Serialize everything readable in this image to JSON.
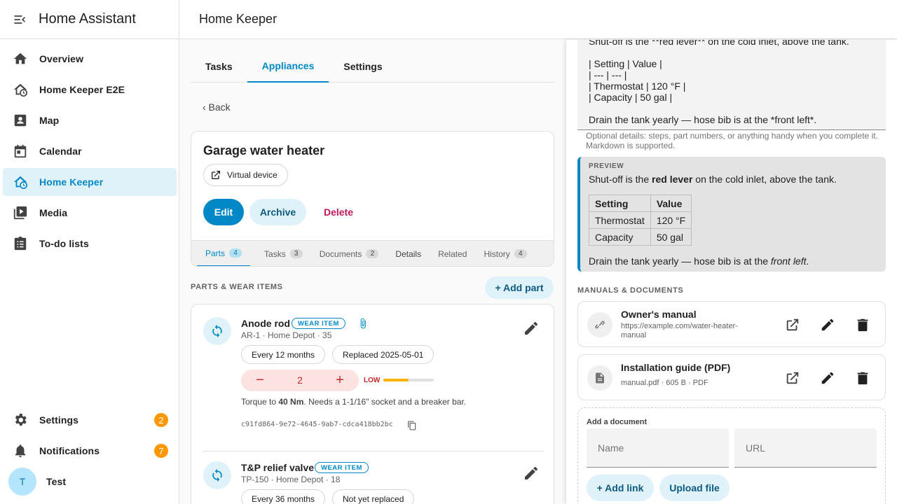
{
  "sidebar": {
    "title": "Home Assistant",
    "items": [
      {
        "label": "Overview"
      },
      {
        "label": "Home Keeper E2E"
      },
      {
        "label": "Map"
      },
      {
        "label": "Calendar"
      },
      {
        "label": "Home Keeper"
      },
      {
        "label": "Media"
      },
      {
        "label": "To-do lists"
      }
    ],
    "settings": {
      "label": "Settings",
      "badge": "2"
    },
    "notifications": {
      "label": "Notifications",
      "badge": "7"
    },
    "user": {
      "initial": "T",
      "name": "Test"
    }
  },
  "header": {
    "title": "Home Keeper"
  },
  "tabs": [
    {
      "label": "Tasks"
    },
    {
      "label": "Appliances"
    },
    {
      "label": "Settings"
    }
  ],
  "back_label": "‹ Back",
  "device": {
    "title": "Garage water heater",
    "chip": "Virtual device",
    "edit": "Edit",
    "archive": "Archive",
    "delete": "Delete",
    "subtabs": [
      {
        "label": "Parts",
        "count": "4"
      },
      {
        "label": "Tasks",
        "count": "3"
      },
      {
        "label": "Documents",
        "count": "2"
      },
      {
        "label": "Details"
      },
      {
        "label": "Related"
      },
      {
        "label": "History",
        "count": "4"
      }
    ]
  },
  "parts": {
    "section_title": "PARTS & WEAR ITEMS",
    "add_label": "+ Add part",
    "items": [
      {
        "name": "Anode rod",
        "badge": "WEAR ITEM",
        "sub": "AR-1 · Home Depot · 35",
        "interval": "Every 12 months",
        "status": "Replaced 2025-05-01",
        "quantity": "2",
        "stock_label": "LOW",
        "stock_level": 0.5,
        "note_pre": "Torque to ",
        "note_bold": "40 Nm",
        "note_post": ". Needs a 1-1/16\" socket and a breaker bar.",
        "uuid": "c91fd864-9e72-4645-9ab7-cdca418bb2bc"
      },
      {
        "name": "T&P relief valve",
        "badge": "WEAR ITEM",
        "sub": "TP-150 · Home Depot · 18",
        "interval": "Every 36 months",
        "status": "Not yet replaced"
      }
    ]
  },
  "notes_editor": {
    "lines": [
      "Shut-off is the **red lever** on the cold inlet, above the tank.",
      "",
      "| Setting | Value |",
      "| --- | --- |",
      "| Thermostat | 120 °F |",
      "| Capacity | 50 gal |",
      "",
      "Drain the tank yearly — hose bib is at the *front left*."
    ],
    "helper1": "Optional details: steps, part numbers, or anything handy when you complete it.",
    "helper2": "Markdown is supported."
  },
  "preview": {
    "label": "PREVIEW",
    "line1_pre": "Shut-off is the ",
    "line1_bold": "red lever",
    "line1_post": " on the cold inlet, above the tank.",
    "table_headers": [
      "Setting",
      "Value"
    ],
    "table_rows": [
      [
        "Thermostat",
        "120 °F"
      ],
      [
        "Capacity",
        "50 gal"
      ]
    ],
    "line2_pre": "Drain the tank yearly — hose bib is at the ",
    "line2_em": "front left",
    "line2_post": "."
  },
  "documents": {
    "section_title": "MANUALS & DOCUMENTS",
    "items": [
      {
        "name": "Owner's manual",
        "sub1": "https://example.com/water-heater-",
        "sub2": "manual"
      },
      {
        "name": "Installation guide (PDF)",
        "sub1": "manual.pdf · 605 B · PDF"
      }
    ],
    "add": {
      "title": "Add a document",
      "name_placeholder": "Name",
      "url_placeholder": "URL",
      "add_link": "+ Add link",
      "upload": "Upload file"
    }
  },
  "colors": {
    "accent": "#0288c7",
    "badge": "#ff9800",
    "danger": "#c2185b"
  }
}
